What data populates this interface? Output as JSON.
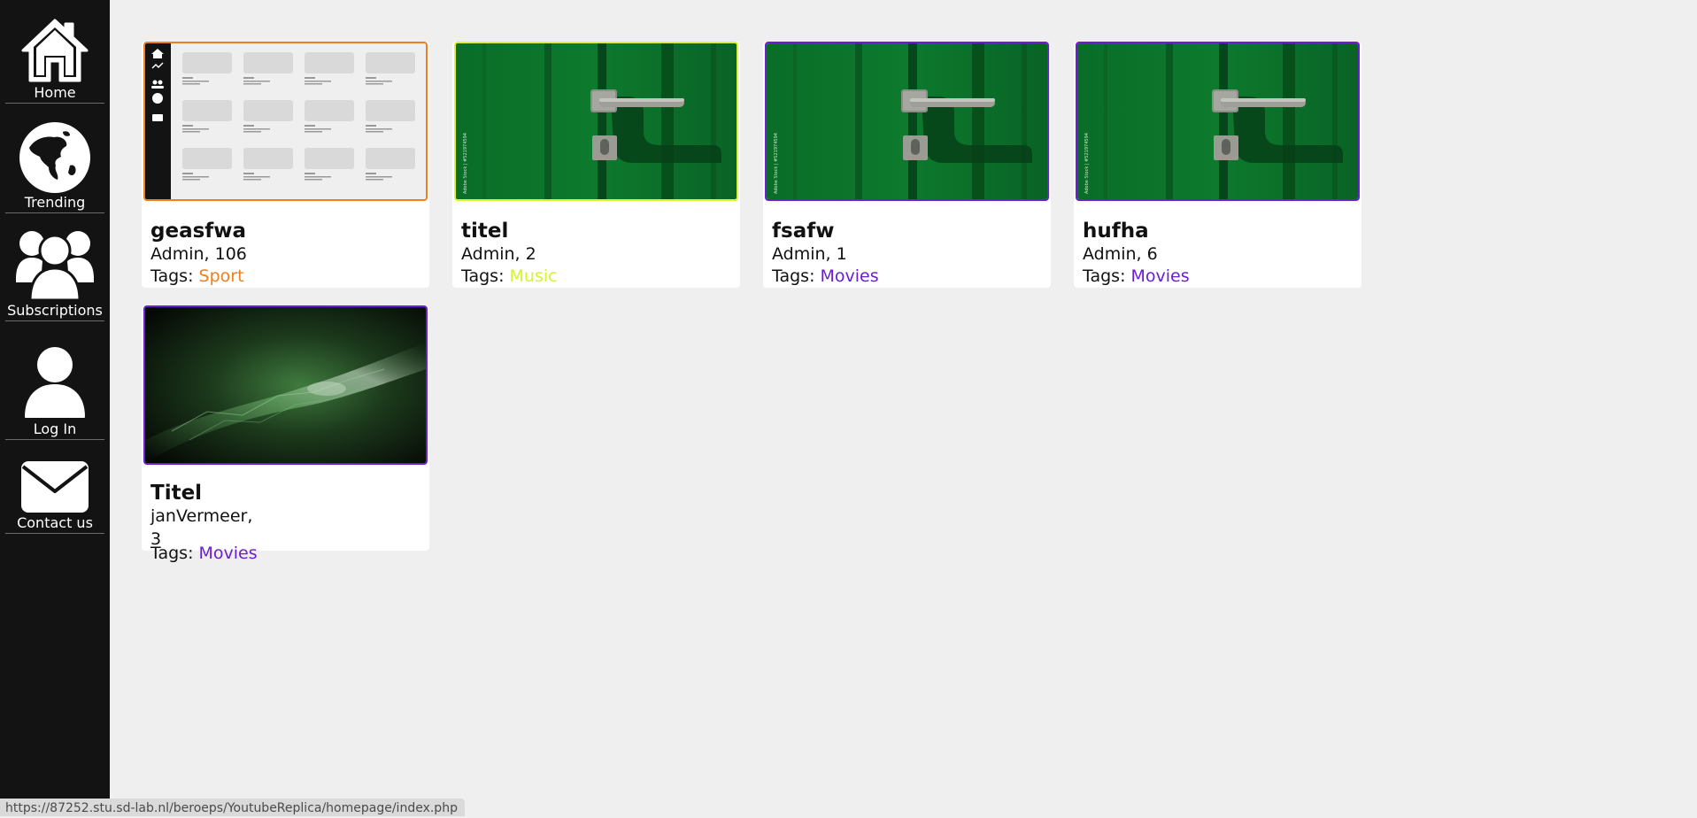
{
  "sidebar": {
    "items": [
      {
        "label": "Home",
        "icon": "home-icon"
      },
      {
        "label": "Trending",
        "icon": "globe-icon"
      },
      {
        "label": "Subscriptions",
        "icon": "users-icon"
      },
      {
        "label": "Log In",
        "icon": "user-icon"
      },
      {
        "label": "Contact us",
        "icon": "mail-icon"
      }
    ]
  },
  "videos": [
    {
      "title": "geasfwa",
      "meta": "Admin, 106",
      "tags_label": "Tags:",
      "tag": "Sport",
      "tag_color": "#f07d1e",
      "thumbnail": "screenshot-thumbnail"
    },
    {
      "title": "titel",
      "meta": "Admin, 2",
      "tags_label": "Tags:",
      "tag": "Music",
      "tag_color": "#d6f52c",
      "thumbnail": "green-door-thumbnail"
    },
    {
      "title": "fsafw",
      "meta": "Admin, 1",
      "tags_label": "Tags:",
      "tag": "Movies",
      "tag_color": "#6a1fd1",
      "thumbnail": "green-door-thumbnail"
    },
    {
      "title": "hufha",
      "meta": "Admin, 6",
      "tags_label": "Tags:",
      "tag": "Movies",
      "tag_color": "#6a1fd1",
      "thumbnail": "green-door-thumbnail"
    },
    {
      "title": "Titel",
      "meta_line1": "janVermeer,",
      "meta_line2": "3",
      "tags_label": "Tags:",
      "tag": "Movies",
      "tag_color": "#6a1fd1",
      "thumbnail": "green-abstract-thumbnail"
    }
  ],
  "status_bar": {
    "url": "https://87252.stu.sd-lab.nl/beroeps/YoutubeReplica/homepage/index.php"
  },
  "colors": {
    "sidebar_bg": "#131313",
    "page_bg": "#efefef",
    "sport": "#f07d1e",
    "music": "#d6f52c",
    "movies": "#6a1fd1"
  }
}
